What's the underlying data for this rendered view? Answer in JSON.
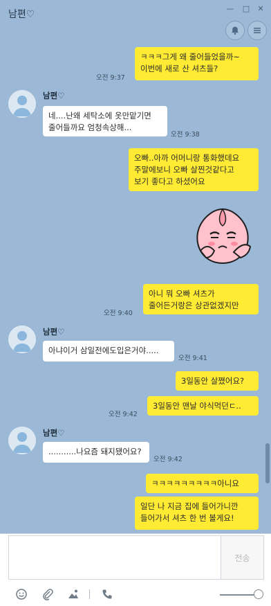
{
  "window": {
    "title": "남편♡",
    "minimize": "—",
    "maximize": "□",
    "close": "✕"
  },
  "header": {
    "bell_icon": "bell-icon",
    "menu_icon": "menu-icon"
  },
  "messages": [
    {
      "text": "ㅋㅋㅋ그게 왜 줄어들었을까~\n이번에 새로 산 셔츠들?",
      "time": "오전 9:37"
    },
    {
      "name": "남편♡",
      "text": "네....난왜 세탁소에 옷만맡기면\n줄어들까요 엄청속상해...",
      "time": "오전 9:38"
    },
    {
      "text": "오빠..아까 어머니랑 통화했데요\n주말에보니 오빠 살찐것같다고\n보기 좋다고 하셨어요"
    },
    {
      "sticker": "peach-sticker"
    },
    {
      "text": "아니 뭐 오빠 셔츠가\n줄어든거랑은 상관없겠지만",
      "time": "오전 9:40"
    },
    {
      "name": "남편♡",
      "text": "아냐이거 삼일전에도입은거야.....",
      "time": "오전 9:41"
    },
    {
      "text": "3일동안 살쪘어요?"
    },
    {
      "text": "3일동안 맨날 야식먹던ㄷ..",
      "time": "오전 9:42"
    },
    {
      "name": "남편♡",
      "text": "...........나요즘 돼지됐어요?",
      "time": "오전 9:42"
    },
    {
      "text": "ㅋㅋㅋㅋㅋㅋㅋㅋㅋ아니요"
    },
    {
      "text": "일단 나 지금 집에 들어가니깐\n들어가서 셔츠 한 번 볼게요!"
    }
  ],
  "composer": {
    "send_label": "전송",
    "input_value": ""
  },
  "colors": {
    "background": "#9bb8d6",
    "my_bubble": "#ffeb33",
    "their_bubble": "#ffffff"
  }
}
